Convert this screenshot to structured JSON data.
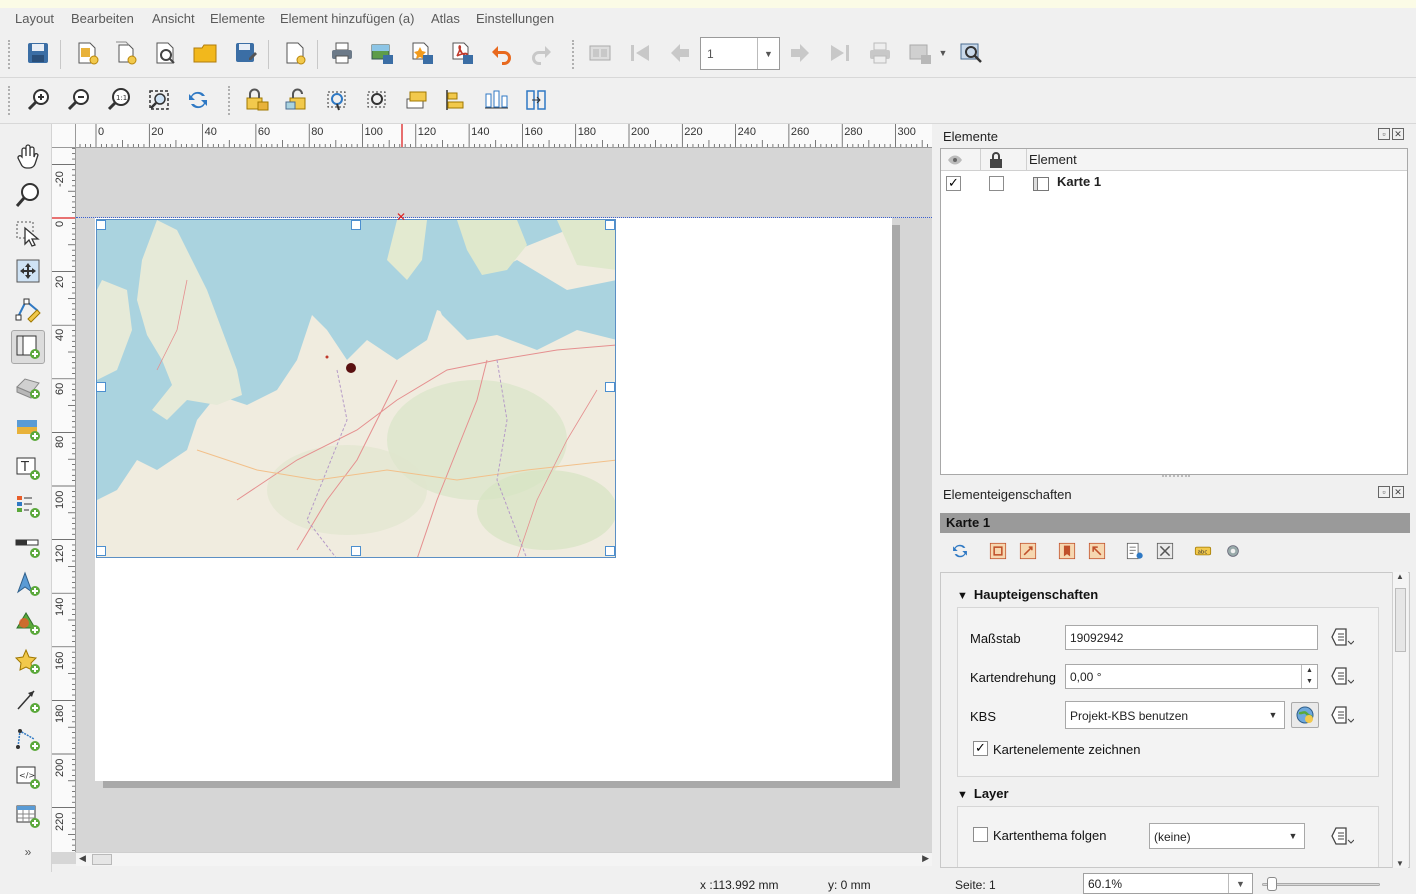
{
  "menu": [
    "Layout",
    "Bearbeiten",
    "Ansicht",
    "Elemente",
    "Element hinzufügen (a)",
    "Atlas",
    "Einstellungen"
  ],
  "toolbar": {
    "page_number": "1"
  },
  "ruler": {
    "h_labels": [
      "0",
      "20",
      "40",
      "60",
      "80",
      "100",
      "120",
      "140",
      "160",
      "180",
      "200",
      "220",
      "240",
      "260",
      "280",
      "300"
    ],
    "v_labels": [
      "-20",
      "0",
      "20",
      "40",
      "60",
      "80",
      "100",
      "120",
      "140",
      "160",
      "180",
      "200",
      "220"
    ]
  },
  "items_panel": {
    "title": "Elemente",
    "column_element": "Element",
    "rows": [
      {
        "name": "Karte 1",
        "visible": true,
        "locked": false
      }
    ]
  },
  "props_panel": {
    "title": "Elementeigenschaften",
    "item_title": "Karte 1",
    "main_group": "Haupteigenschaften",
    "scale_label": "Maßstab",
    "scale_value": "19092942",
    "rotation_label": "Kartendrehung",
    "rotation_value": "0,00 °",
    "crs_label": "KBS",
    "crs_value": "Projekt-KBS benutzen",
    "draw_items_label": "Kartenelemente zeichnen",
    "draw_items_checked": true,
    "layer_group": "Layer",
    "follow_theme_label": "Kartenthema folgen",
    "theme_value": "(keine)"
  },
  "status": {
    "x": "x :113.992 mm",
    "y": "y: 0 mm",
    "page": "Seite: 1",
    "zoom": "60.1%"
  },
  "colors": {
    "selection": "#4c8fcf",
    "map_water": "#aad3df",
    "map_land": "#f2efe9"
  }
}
